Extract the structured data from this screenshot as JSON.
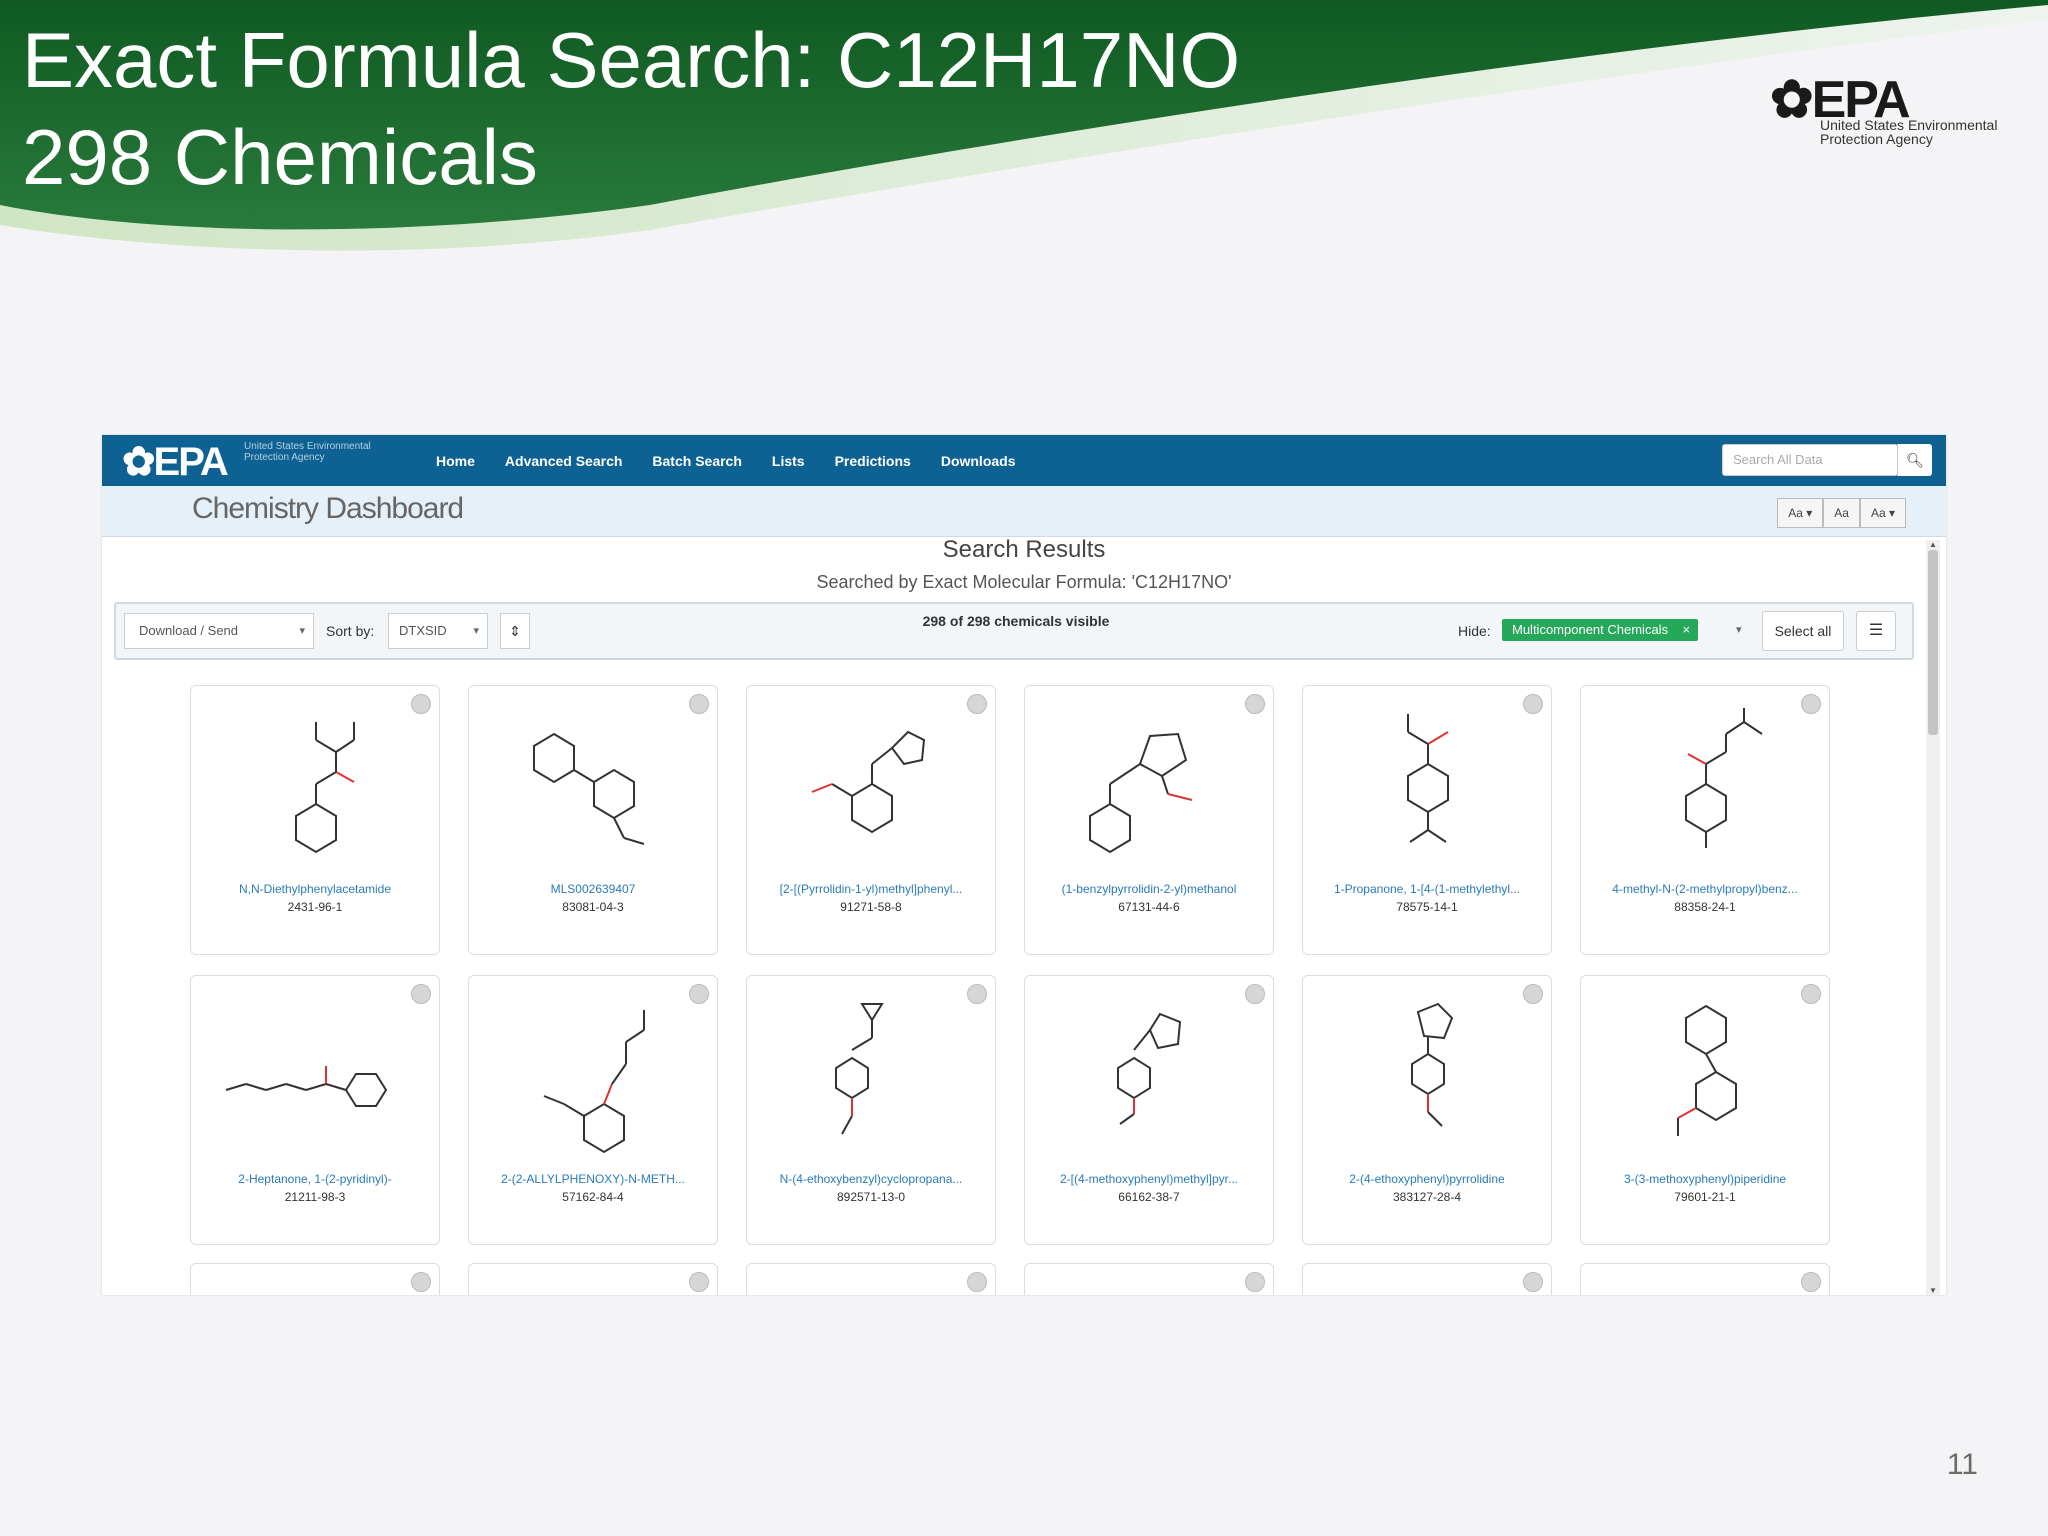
{
  "slide": {
    "title_line1": "Exact Formula Search: C12H17NO",
    "title_line2": "298 Chemicals",
    "logo_mark": "EPA",
    "logo_sub": "United States Environmental Protection Agency",
    "page_number": "11"
  },
  "nav": {
    "logo": "EPA",
    "logo_sub": "United States Environmental Protection Agency",
    "links": [
      "Home",
      "Advanced Search",
      "Batch Search",
      "Lists",
      "Predictions",
      "Downloads"
    ],
    "search_placeholder": "Search All Data",
    "search_icon": "search-icon"
  },
  "dashboard": {
    "title": "Chemistry Dashboard",
    "font_buttons": [
      "Aa ▾",
      "Aa",
      "Aa ▾"
    ]
  },
  "results": {
    "title": "Search Results",
    "subtitle": "Searched by Exact Molecular Formula: 'C12H17NO'",
    "download_label": "Download / Send",
    "sort_label": "Sort by:",
    "sort_value": "DTXSID",
    "visible_count": "298 of 298 chemicals visible",
    "hide_label": "Hide:",
    "hide_tag": "Multicomponent Chemicals",
    "select_all": "Select all"
  },
  "cards": [
    {
      "name": "N,N-Diethylphenylacetamide",
      "cas": "2431-96-1"
    },
    {
      "name": "MLS002639407",
      "cas": "83081-04-3"
    },
    {
      "name": "[2-[(Pyrrolidin-1-yl)methyl]phenyl...",
      "cas": "91271-58-8"
    },
    {
      "name": "(1-benzylpyrrolidin-2-yl)methanol",
      "cas": "67131-44-6"
    },
    {
      "name": "1-Propanone, 1-[4-(1-methylethyl...",
      "cas": "78575-14-1"
    },
    {
      "name": "4-methyl-N-(2-methylpropyl)benz...",
      "cas": "88358-24-1"
    },
    {
      "name": "2-Heptanone, 1-(2-pyridinyl)-",
      "cas": "21211-98-3"
    },
    {
      "name": "2-(2-ALLYLPHENOXY)-N-METH...",
      "cas": "57162-84-4"
    },
    {
      "name": "N-(4-ethoxybenzyl)cyclopropana...",
      "cas": "892571-13-0"
    },
    {
      "name": "2-[(4-methoxyphenyl)methyl]pyr...",
      "cas": "66162-38-7"
    },
    {
      "name": "2-(4-ethoxyphenyl)pyrrolidine",
      "cas": "383127-28-4"
    },
    {
      "name": "3-(3-methoxyphenyl)piperidine",
      "cas": "79601-21-1"
    }
  ],
  "colors": {
    "slide_green": "#1d6b2f",
    "nav_blue": "#0e6293",
    "link_blue": "#2a7bb8",
    "tag_green": "#26a85a"
  }
}
